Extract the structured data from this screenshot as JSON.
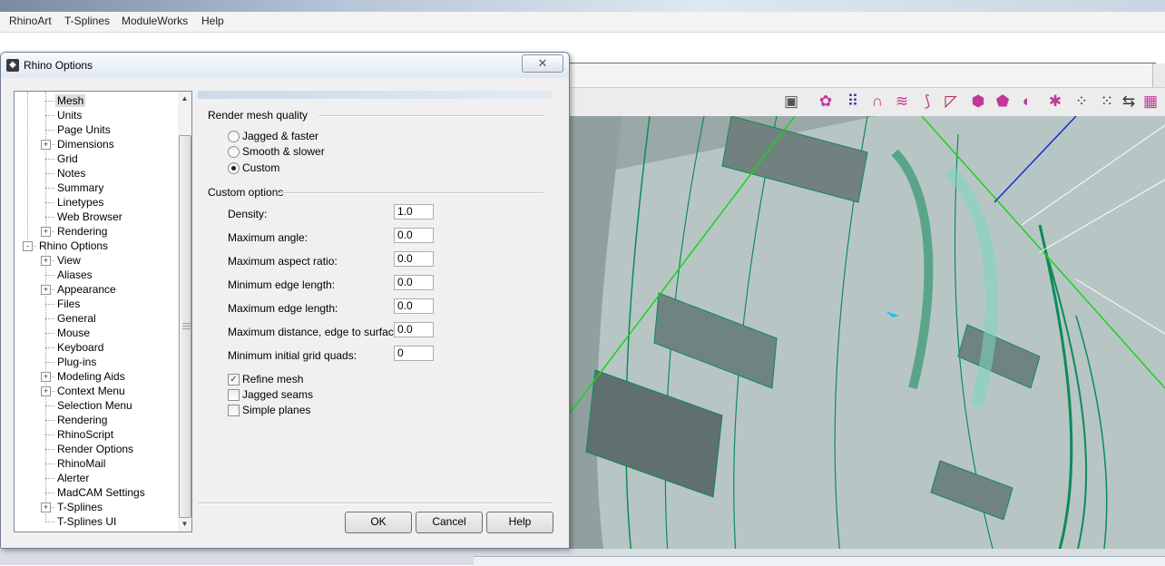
{
  "menubar": {
    "items": [
      "RhinoArt",
      "T-Splines",
      "ModuleWorks",
      "Help"
    ]
  },
  "dialog": {
    "title": "Rhino Options",
    "close_glyph": "✕",
    "tree": [
      {
        "label": "Mesh",
        "level": 1,
        "expander": "",
        "selected": true
      },
      {
        "label": "Units",
        "level": 1,
        "expander": ""
      },
      {
        "label": "Page Units",
        "level": 1,
        "expander": ""
      },
      {
        "label": "Dimensions",
        "level": 1,
        "expander": "+"
      },
      {
        "label": "Grid",
        "level": 1,
        "expander": ""
      },
      {
        "label": "Notes",
        "level": 1,
        "expander": ""
      },
      {
        "label": "Summary",
        "level": 1,
        "expander": ""
      },
      {
        "label": "Linetypes",
        "level": 1,
        "expander": ""
      },
      {
        "label": "Web Browser",
        "level": 1,
        "expander": ""
      },
      {
        "label": "Rendering",
        "level": 1,
        "expander": "+"
      },
      {
        "label": "Rhino Options",
        "level": 0,
        "expander": "-"
      },
      {
        "label": "View",
        "level": 1,
        "expander": "+"
      },
      {
        "label": "Aliases",
        "level": 1,
        "expander": ""
      },
      {
        "label": "Appearance",
        "level": 1,
        "expander": "+"
      },
      {
        "label": "Files",
        "level": 1,
        "expander": ""
      },
      {
        "label": "General",
        "level": 1,
        "expander": ""
      },
      {
        "label": "Mouse",
        "level": 1,
        "expander": ""
      },
      {
        "label": "Keyboard",
        "level": 1,
        "expander": ""
      },
      {
        "label": "Plug-ins",
        "level": 1,
        "expander": ""
      },
      {
        "label": "Modeling Aids",
        "level": 1,
        "expander": "+"
      },
      {
        "label": "Context Menu",
        "level": 1,
        "expander": "+"
      },
      {
        "label": "Selection Menu",
        "level": 1,
        "expander": ""
      },
      {
        "label": "Rendering",
        "level": 1,
        "expander": ""
      },
      {
        "label": "RhinoScript",
        "level": 1,
        "expander": ""
      },
      {
        "label": "Render Options",
        "level": 1,
        "expander": ""
      },
      {
        "label": "RhinoMail",
        "level": 1,
        "expander": ""
      },
      {
        "label": "Alerter",
        "level": 1,
        "expander": ""
      },
      {
        "label": "MadCAM Settings",
        "level": 1,
        "expander": ""
      },
      {
        "label": "T-Splines",
        "level": 1,
        "expander": "+"
      },
      {
        "label": "T-Splines UI",
        "level": 1,
        "expander": ""
      }
    ],
    "render_quality": {
      "heading": "Render mesh quality",
      "options": [
        {
          "label": "Jagged & faster",
          "checked": false
        },
        {
          "label": "Smooth & slower",
          "checked": false
        },
        {
          "label": "Custom",
          "checked": true
        }
      ]
    },
    "custom": {
      "heading": "Custom options",
      "fields": [
        {
          "label": "Density:",
          "value": "1.0"
        },
        {
          "label": "Maximum angle:",
          "value": "0.0"
        },
        {
          "label": "Maximum aspect ratio:",
          "value": "0.0"
        },
        {
          "label": "Minimum edge length:",
          "value": "0.0"
        },
        {
          "label": "Maximum edge length:",
          "value": "0.0"
        },
        {
          "label": "Maximum distance, edge to surface:",
          "value": "0.0"
        },
        {
          "label": "Minimum initial grid quads:",
          "value": "0"
        }
      ],
      "checks": [
        {
          "label": "Refine mesh",
          "checked": true
        },
        {
          "label": "Jagged seams",
          "checked": false
        },
        {
          "label": "Simple planes",
          "checked": false
        }
      ]
    },
    "buttons": {
      "ok": "OK",
      "cancel": "Cancel",
      "help": "Help"
    }
  },
  "toolbar": {
    "icons": [
      {
        "name": "camera-icon",
        "glyph": "▣",
        "color": "#555555"
      },
      {
        "name": "blend-surface-icon",
        "glyph": "✿",
        "color": "#c2399a"
      },
      {
        "name": "point-grid-icon",
        "glyph": "⠿",
        "color": "#333399"
      },
      {
        "name": "arch-icon",
        "glyph": "∩",
        "color": "#c2399a"
      },
      {
        "name": "cylinder-strip-icon",
        "glyph": "≋",
        "color": "#c2399a"
      },
      {
        "name": "fold-surface-icon",
        "glyph": "⟆",
        "color": "#c2399a"
      },
      {
        "name": "cage-edit-icon",
        "glyph": "◸",
        "color": "#a0203a"
      },
      {
        "name": "polyhedron-icon",
        "glyph": "⬢",
        "color": "#c2399a"
      },
      {
        "name": "box-icon",
        "glyph": "⬟",
        "color": "#c2399a"
      },
      {
        "name": "pipe-icon",
        "glyph": "◐",
        "color": "#c2399a"
      },
      {
        "name": "network-surface-icon",
        "glyph": "✱",
        "color": "#c2399a"
      },
      {
        "name": "point-array-icon",
        "glyph": "⁘",
        "color": "#333333"
      },
      {
        "name": "control-points-icon",
        "glyph": "⁙",
        "color": "#333333"
      },
      {
        "name": "move-uvn-icon",
        "glyph": "⇆",
        "color": "#333333"
      },
      {
        "name": "mesh-grid-icon",
        "glyph": "▦",
        "color": "#c2399a"
      },
      {
        "name": "mesh-patch-icon",
        "glyph": "▤",
        "color": "#c2399a"
      }
    ]
  }
}
